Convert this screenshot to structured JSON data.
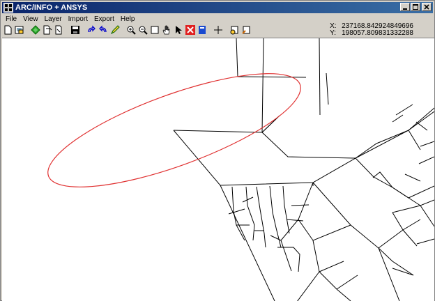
{
  "window": {
    "title": "ARC/INFO + ANSYS"
  },
  "menu": {
    "items": [
      "File",
      "View",
      "Layer",
      "Import",
      "Export",
      "Help"
    ]
  },
  "toolbar": {
    "buttons": [
      "new-icon",
      "open-icon",
      "layers-icon",
      "copy-icon",
      "paste-icon",
      "save-icon",
      "redo-icon",
      "undo-icon",
      "pencil-icon",
      "zoom-in-icon",
      "zoom-out-icon",
      "zoom-box-icon",
      "pan-hand-icon",
      "select-arrow-icon",
      "delete-red-icon",
      "info-blue-icon",
      "crosshair-icon",
      "identify-icon",
      "query-icon"
    ]
  },
  "coordinates": {
    "x_label": "X:",
    "x_value": "237168.842924849696",
    "y_label": "Y:",
    "y_value": "198057.809831332288"
  },
  "map": {
    "line_color": "#000000",
    "selection_color": "#e03030",
    "background": "#ffffff"
  }
}
